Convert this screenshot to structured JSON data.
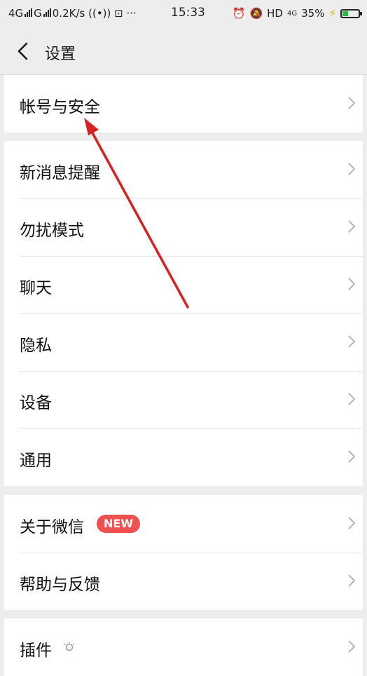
{
  "status_bar": {
    "left": "4G 信号 G 信号 0.2K/s",
    "time": "15:33",
    "hd": "HD",
    "net": "4G",
    "battery": "35%",
    "battery_level": 0.35
  },
  "nav": {
    "title": "设置"
  },
  "groups": [
    {
      "items": [
        {
          "label": "帐号与安全"
        }
      ]
    },
    {
      "items": [
        {
          "label": "新消息提醒"
        },
        {
          "label": "勿扰模式"
        },
        {
          "label": "聊天"
        },
        {
          "label": "隐私"
        },
        {
          "label": "设备"
        },
        {
          "label": "通用"
        }
      ]
    },
    {
      "items": [
        {
          "label": "关于微信",
          "badge": "NEW"
        },
        {
          "label": "帮助与反馈"
        }
      ]
    },
    {
      "items": [
        {
          "label": "插件"
        }
      ]
    }
  ],
  "colors": {
    "background": "#ededed",
    "badge": "#f05050",
    "annotation_arrow": "#d92020"
  }
}
